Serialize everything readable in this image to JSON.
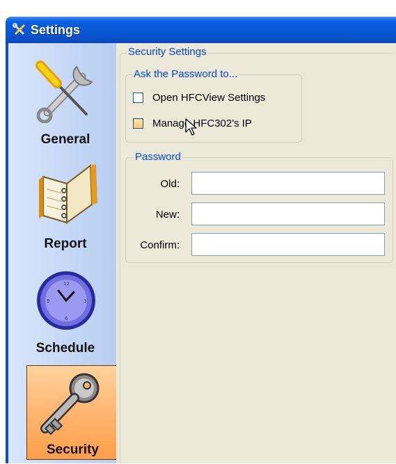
{
  "window": {
    "title": "Settings",
    "title_icon": "tools-icon"
  },
  "sidebar": {
    "items": [
      {
        "label": "General",
        "icon": "tools-icon",
        "selected": false
      },
      {
        "label": "Report",
        "icon": "notebook-icon",
        "selected": false
      },
      {
        "label": "Schedule",
        "icon": "clock-icon",
        "selected": false
      },
      {
        "label": "Security",
        "icon": "key-icon",
        "selected": true
      }
    ]
  },
  "security": {
    "group_title": "Security Settings",
    "ask_group": {
      "title": "Ask the Password to...",
      "options": [
        {
          "label": "Open HFCView Settings",
          "checked": false
        },
        {
          "label": "Manage HFC302's IP",
          "checked": false,
          "hover": true
        }
      ]
    },
    "password_group": {
      "title": "Password",
      "fields": [
        {
          "label": "Old:",
          "value": ""
        },
        {
          "label": "New:",
          "value": ""
        },
        {
          "label": "Confirm:",
          "value": ""
        }
      ]
    }
  },
  "colors": {
    "titlebar": "#0757d6",
    "group_title": "#0046d5",
    "selected_item": "#ffb36d",
    "content_bg": "#ece9d8"
  }
}
